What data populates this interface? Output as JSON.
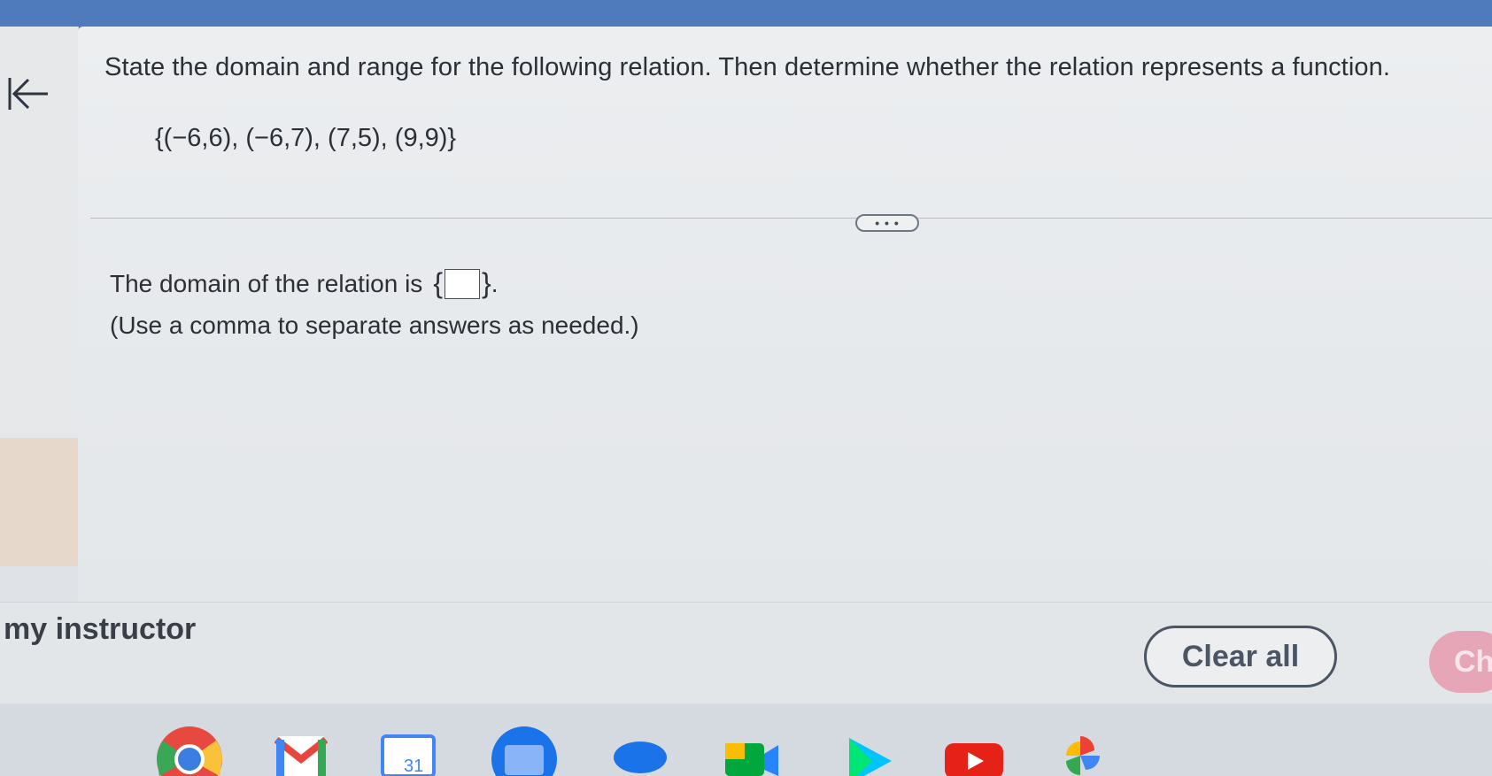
{
  "question": {
    "prompt": "State the domain and range for the following relation. Then determine whether the relation represents a function.",
    "relation": "{(−6,6), (−6,7), (7,5), (9,9)}"
  },
  "divider": {
    "more_label": "• • •"
  },
  "answer": {
    "domain_label": "The domain of the relation is",
    "brace_open": "{",
    "brace_close": "}",
    "period": ".",
    "note": "(Use a comma to separate answers as needed.)",
    "domain_value": ""
  },
  "footer": {
    "instructor_text": "my instructor",
    "clear_all_label": "Clear all",
    "check_label": "Ch"
  },
  "shelf": {
    "apps": [
      "chrome-icon",
      "gmail-icon",
      "calendar-icon",
      "files-icon",
      "chat-icon",
      "meet-icon",
      "play-store-icon",
      "youtube-icon",
      "photos-icon"
    ],
    "calendar_day": "31"
  },
  "colors": {
    "topbar": "#4f7bbd",
    "text": "#2b2f36",
    "button_border": "#4b5563",
    "check_button": "#e6a6b8"
  }
}
